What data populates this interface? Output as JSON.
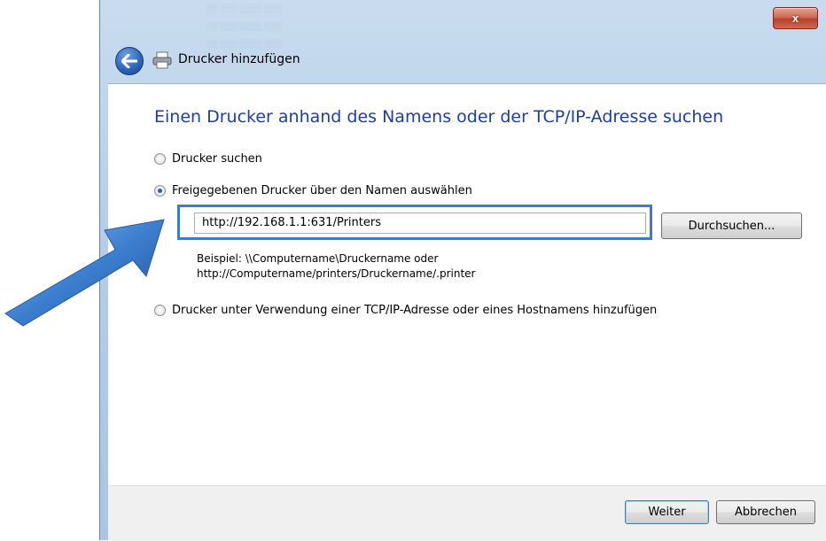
{
  "window": {
    "title": "Drucker hinzufügen",
    "close_glyph": "x"
  },
  "page": {
    "heading": "Einen Drucker anhand des Namens oder der TCP/IP-Adresse suchen"
  },
  "options": [
    {
      "label": "Drucker suchen",
      "selected": false
    },
    {
      "label": "Freigegebenen Drucker über den Namen auswählen",
      "selected": true
    },
    {
      "label": "Drucker unter Verwendung einer TCP/IP-Adresse oder eines Hostnamens hinzufügen",
      "selected": false
    }
  ],
  "share_input": {
    "value": "http://192.168.1.1:631/Printers",
    "browse_label": "Durchsuchen..."
  },
  "example": {
    "line1": "Beispiel: \\\\Computername\\Druckername oder",
    "line2": "http://Computername/printers/Druckername/.printer"
  },
  "footer": {
    "next_label": "Weiter",
    "cancel_label": "Abbrechen"
  },
  "icons": [
    "back-arrow-icon",
    "printer-icon",
    "close-icon",
    "pointer-arrow-icon"
  ],
  "colors": {
    "heading": "#1e3e9e",
    "highlight": "#3d7ac7",
    "close": "#c7503a"
  }
}
